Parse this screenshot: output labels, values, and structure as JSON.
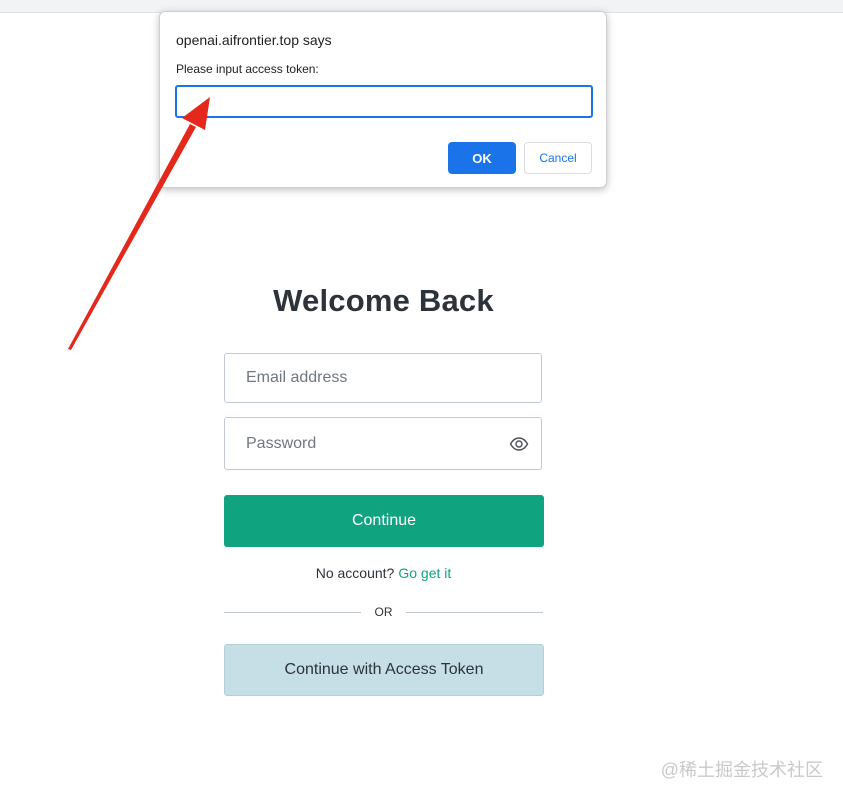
{
  "dialog": {
    "title": "openai.aifrontier.top says",
    "message": "Please input access token:",
    "input_value": "",
    "ok_label": "OK",
    "cancel_label": "Cancel"
  },
  "login": {
    "title": "Welcome Back",
    "email_placeholder": "Email address",
    "password_placeholder": "Password",
    "password_toggle_icon": "eye-icon",
    "continue_label": "Continue",
    "no_account_text": "No account?",
    "signup_link": "Go get it",
    "divider_text": "OR",
    "token_button_label": "Continue with Access Token"
  },
  "watermark": "@稀土掘金技术社区",
  "colors": {
    "accent": "#10a37f",
    "dialog_accent": "#1a73e8",
    "token_button_bg": "#c6dfe6",
    "annotation_arrow": "#e5281c"
  }
}
